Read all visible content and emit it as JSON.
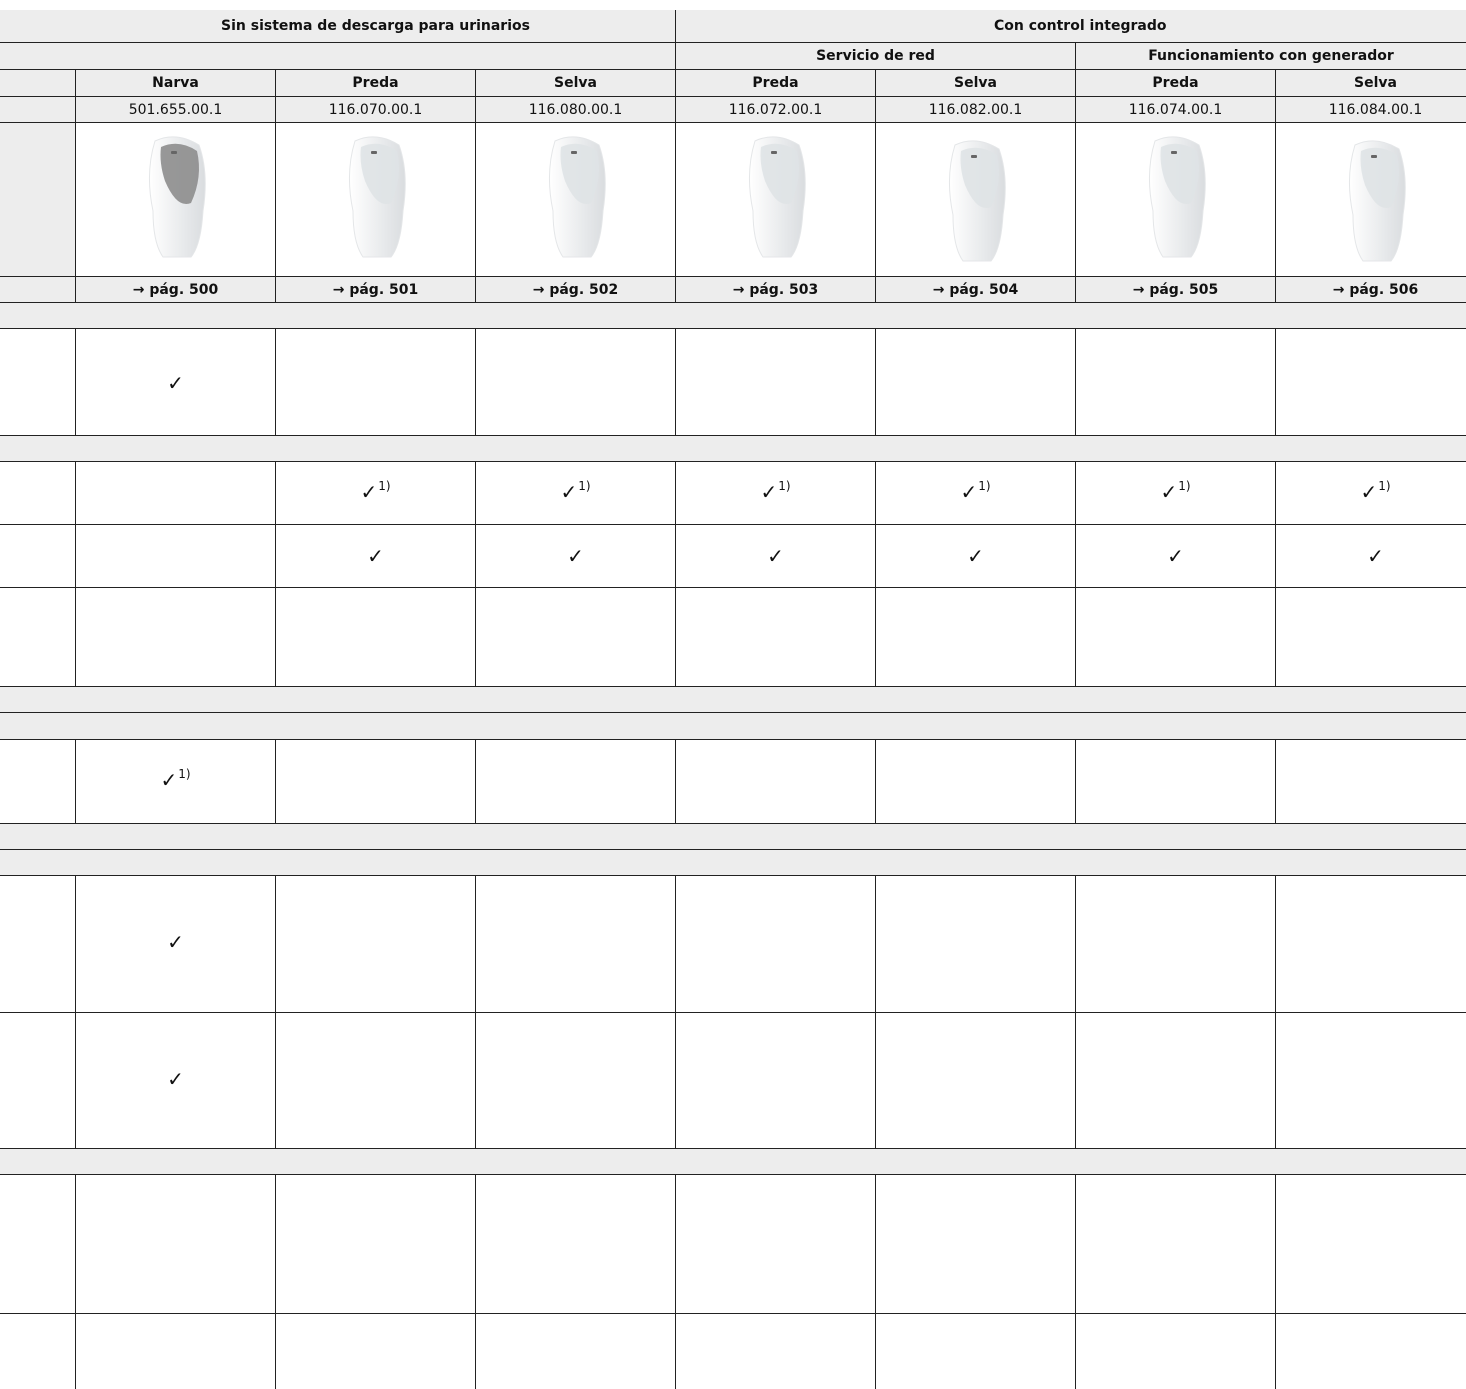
{
  "header": {
    "group_without": "Sin sistema de descarga para urinarios",
    "group_with": "Con control integrado",
    "sub_network": "Servicio de red",
    "sub_generator": "Funcionamiento con generador"
  },
  "products": [
    {
      "name": "Narva",
      "code": "501.655.00.1",
      "page": "→ pág. 500"
    },
    {
      "name": "Preda",
      "code": "116.070.00.1",
      "page": "→ pág. 501"
    },
    {
      "name": "Selva",
      "code": "116.080.00.1",
      "page": "→ pág. 502"
    },
    {
      "name": "Preda",
      "code": "116.072.00.1",
      "page": "→ pág. 503"
    },
    {
      "name": "Selva",
      "code": "116.082.00.1",
      "page": "→ pág. 504"
    },
    {
      "name": "Preda",
      "code": "116.074.00.1",
      "page": "→ pág. 505"
    },
    {
      "name": "Selva",
      "code": "116.084.00.1",
      "page": "→ pág. 506"
    }
  ],
  "marks": {
    "check": "✓",
    "footnote": "1)"
  },
  "icons": {
    "urinal_narva": "urinal-image",
    "urinal_preda": "urinal-image",
    "urinal_selva": "urinal-image"
  }
}
